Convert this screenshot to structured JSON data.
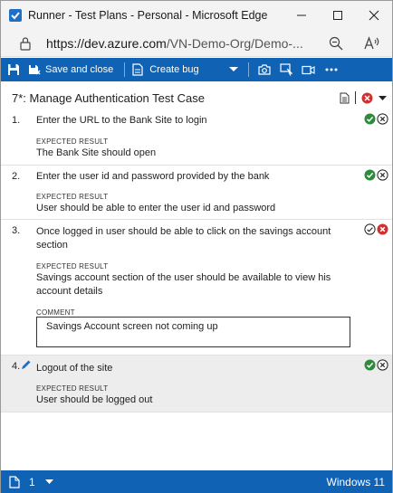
{
  "window": {
    "title": "Runner - Test Plans - Personal - Microsoft Edge",
    "url_host": "https://dev.azure.com",
    "url_path": "/VN-Demo-Org/Demo-..."
  },
  "toolbar": {
    "save_label": "Save and close",
    "create_bug_label": "Create bug"
  },
  "test_case": {
    "title": "7*: Manage Authentication Test Case"
  },
  "steps": [
    {
      "number": "1.",
      "action": "Enter the URL to the Bank Site to login",
      "expected_label": "EXPECTED RESULT",
      "expected": "The Bank Site should open",
      "status": "none"
    },
    {
      "number": "2.",
      "action": "Enter the user id and password provided by the bank",
      "expected_label": "EXPECTED RESULT",
      "expected": "User should be able to enter the user id and password",
      "status": "none"
    },
    {
      "number": "3.",
      "action": "Once logged in user should be able to click on the savings account section",
      "expected_label": "EXPECTED RESULT",
      "expected": "Savings account section of the user should be available to view his account details",
      "comment_label": "COMMENT",
      "comment": "Savings Account screen not coming up",
      "status": "failed"
    },
    {
      "number": "4.",
      "action": "Logout of the site",
      "expected_label": "EXPECTED RESULT",
      "expected": "User should be logged out",
      "status": "active"
    }
  ],
  "statusbar": {
    "attachments_count": "1",
    "os_label": "Windows 11"
  },
  "colors": {
    "toolbar_bg": "#0f62b4",
    "pass_green": "#2e8b3c",
    "fail_red": "#d32f2f",
    "active_row_bg": "#ededed"
  },
  "icons": {
    "app": "azure-test-plans-icon",
    "lock": "lock-icon",
    "zoom": "zoom-out-icon",
    "read_aloud": "read-aloud-icon",
    "save": "save-icon",
    "create_bug": "bug-icon",
    "screenshot": "camera-icon",
    "capture_actions": "capture-actions-icon",
    "record": "video-icon",
    "more": "more-icon"
  }
}
